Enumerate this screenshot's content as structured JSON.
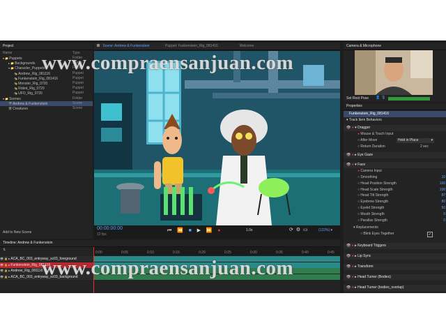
{
  "watermark": "www.compraensanjuan.com",
  "project": {
    "title": "Project",
    "col_name": "Name",
    "col_type": "Type",
    "items": [
      {
        "name": "Puppets",
        "type": "Folder"
      },
      {
        "name": "Backgrounds",
        "type": "Folder"
      },
      {
        "name": "Character_Puppets",
        "type": "Folder"
      },
      {
        "name": "Andrew_Rig_081116",
        "type": "Puppet"
      },
      {
        "name": "Funkenstein_Rig_081416",
        "type": "Puppet"
      },
      {
        "name": "Monster_Rig_0720",
        "type": "Puppet"
      },
      {
        "name": "Robot_Rig_0720",
        "type": "Puppet"
      },
      {
        "name": "UFO_Rig_0720",
        "type": "Puppet"
      },
      {
        "name": "Scenes",
        "type": "Folder"
      },
      {
        "name": "Andrew & Funkenstein",
        "type": "Scene"
      },
      {
        "name": "Creatures",
        "type": "Scene"
      }
    ],
    "add_scene": "Add to New Scene"
  },
  "tabs": {
    "scene": "Scene: Andrew & Funkenstein",
    "puppet": "Puppet: Funkenstein_Rig_081416",
    "welcome": "Welcome"
  },
  "transport": {
    "timecode": "00:00:00:00",
    "fps": "12 fps",
    "speed": "1.0x",
    "zoom": "(122%)"
  },
  "camera": {
    "title": "Camera & Microphone",
    "set_rest_pose": "Set Rest Pose"
  },
  "properties": {
    "title": "Properties",
    "puppet_name": "Funkenstein_Rig_081416",
    "track_behaviors": "Track Item Behaviors",
    "dragger": "Dragger",
    "mouse_touch": "Mouse & Touch Input",
    "after_move": "After Move",
    "after_move_value": "Hold in Place",
    "return_duration": "Return Duration",
    "return_duration_value": "2 sec",
    "eye_gaze": "Eye Gaze",
    "face": "Face",
    "camera_input": "Camera Input",
    "params": [
      {
        "label": "Smoothing",
        "value": "10 %"
      },
      {
        "label": "Head Position Strength",
        "value": "100 %"
      },
      {
        "label": "Head Scale Strength",
        "value": "100 %"
      },
      {
        "label": "Head Tilt Strength",
        "value": "87 %"
      },
      {
        "label": "Eyebrow Strength",
        "value": "80 %"
      },
      {
        "label": "Eyelid Strength",
        "value": "50 %"
      },
      {
        "label": "Mouth Strength",
        "value": "0 %"
      },
      {
        "label": "Parallax Strength",
        "value": "0 %"
      }
    ],
    "replacements": "Replacements",
    "blink": "Blink Eyes Together",
    "keyboard_triggers": "Keyboard Triggers",
    "lip_sync": "Lip Sync",
    "transform": "Transform",
    "head_turner": "Head Turner (Bodies)",
    "head_turner2": "Head Turner (bodies_overlap)"
  },
  "timeline": {
    "title": "Timeline: Andrew & Funkenstein",
    "ticks": [
      "0:00",
      "0:05",
      "0:10",
      "0:15",
      "0:20",
      "0:25",
      "0:30",
      "0:35",
      "0:40",
      "0:45"
    ],
    "tracks": [
      "ACA_BC_003_entryway_sc03_foreground",
      "Funkenstein_Rig_081416",
      "Andrew_Rig_081116",
      "ACA_BC_003_entryway_sc03_background"
    ]
  },
  "colors": {
    "accent": "#3b7ddd",
    "selected_track": "#b8282f",
    "track_green": "#2e7d4f",
    "track_teal": "#2a8a8a"
  }
}
